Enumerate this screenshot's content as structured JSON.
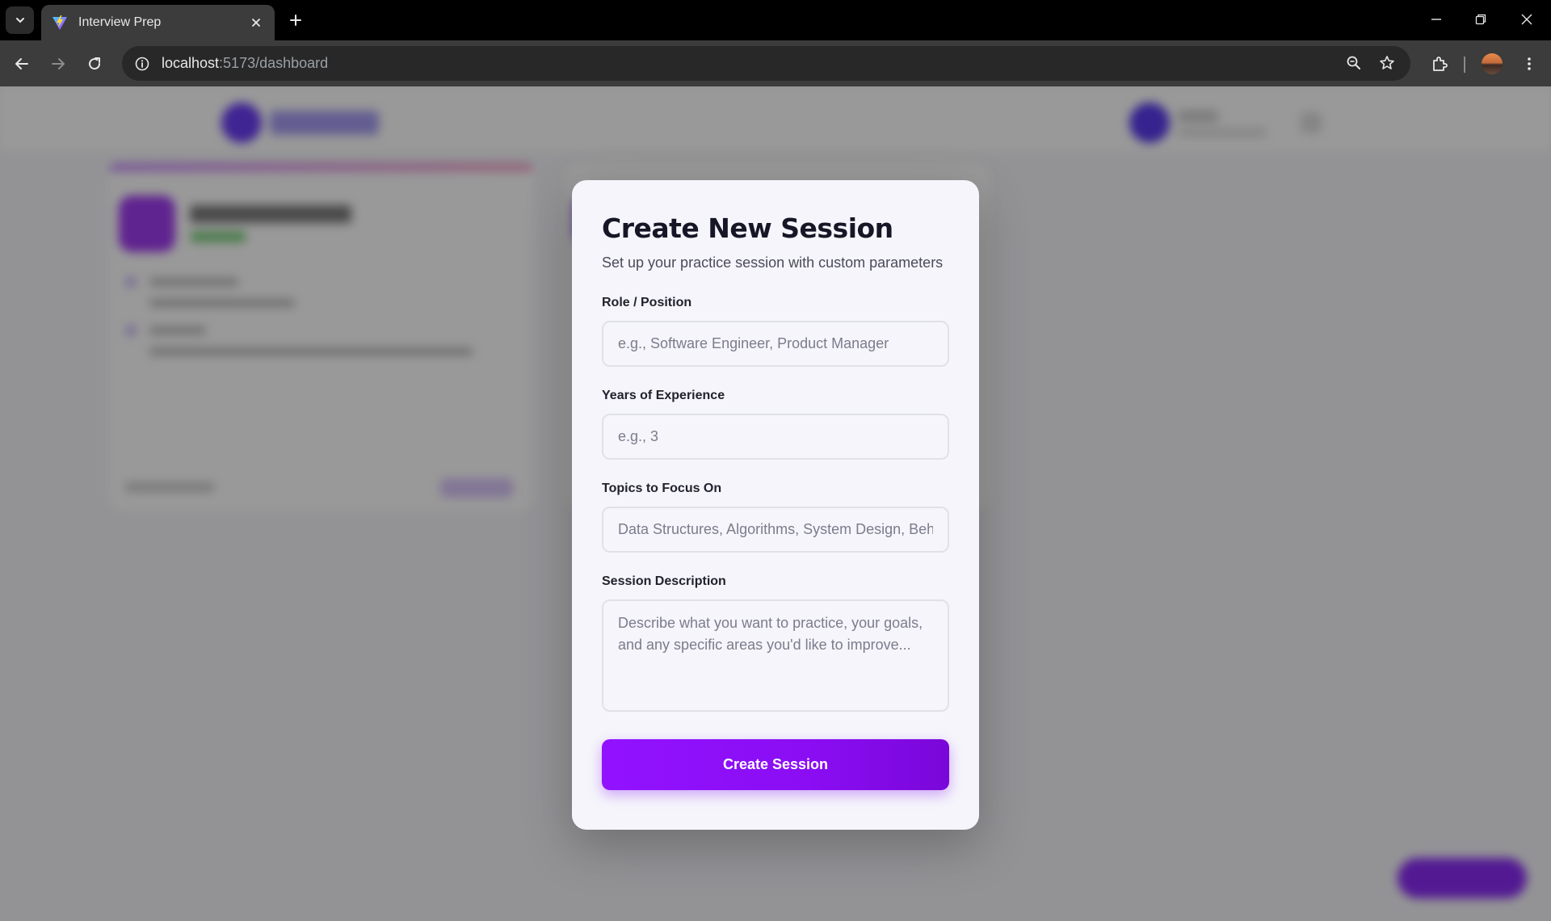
{
  "browser": {
    "tab_title": "Interview Prep",
    "url_host": "localhost",
    "url_path": ":5173/dashboard"
  },
  "modal": {
    "title": "Create New Session",
    "subtitle": "Set up your practice session with custom parameters",
    "role": {
      "label": "Role / Position",
      "placeholder": "e.g., Software Engineer, Product Manager"
    },
    "experience": {
      "label": "Years of Experience",
      "placeholder": "e.g., 3"
    },
    "topics": {
      "label": "Topics to Focus On",
      "placeholder": "Data Structures, Algorithms, System Design, Beha"
    },
    "description": {
      "label": "Session Description",
      "placeholder": "Describe what you want to practice, your goals, and any specific areas you'd like to improve..."
    },
    "submit_label": "Create Session"
  },
  "colors": {
    "accent": "#8a0df3",
    "modal_bg": "#f5f5fb",
    "title": "#161627"
  }
}
